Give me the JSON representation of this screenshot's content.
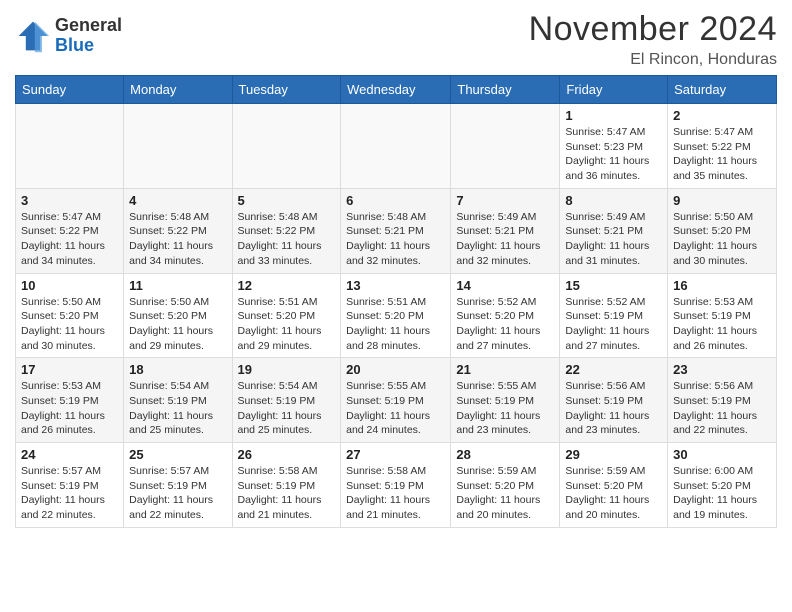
{
  "header": {
    "logo_line1": "General",
    "logo_line2": "Blue",
    "month": "November 2024",
    "location": "El Rincon, Honduras"
  },
  "weekdays": [
    "Sunday",
    "Monday",
    "Tuesday",
    "Wednesday",
    "Thursday",
    "Friday",
    "Saturday"
  ],
  "rows": [
    {
      "cells": [
        {
          "day": "",
          "info": ""
        },
        {
          "day": "",
          "info": ""
        },
        {
          "day": "",
          "info": ""
        },
        {
          "day": "",
          "info": ""
        },
        {
          "day": "",
          "info": ""
        },
        {
          "day": "1",
          "sunrise": "5:47 AM",
          "sunset": "5:23 PM",
          "daylight": "11 hours and 36 minutes."
        },
        {
          "day": "2",
          "sunrise": "5:47 AM",
          "sunset": "5:22 PM",
          "daylight": "11 hours and 35 minutes."
        }
      ]
    },
    {
      "cells": [
        {
          "day": "3",
          "sunrise": "5:47 AM",
          "sunset": "5:22 PM",
          "daylight": "11 hours and 34 minutes."
        },
        {
          "day": "4",
          "sunrise": "5:48 AM",
          "sunset": "5:22 PM",
          "daylight": "11 hours and 34 minutes."
        },
        {
          "day": "5",
          "sunrise": "5:48 AM",
          "sunset": "5:22 PM",
          "daylight": "11 hours and 33 minutes."
        },
        {
          "day": "6",
          "sunrise": "5:48 AM",
          "sunset": "5:21 PM",
          "daylight": "11 hours and 32 minutes."
        },
        {
          "day": "7",
          "sunrise": "5:49 AM",
          "sunset": "5:21 PM",
          "daylight": "11 hours and 32 minutes."
        },
        {
          "day": "8",
          "sunrise": "5:49 AM",
          "sunset": "5:21 PM",
          "daylight": "11 hours and 31 minutes."
        },
        {
          "day": "9",
          "sunrise": "5:50 AM",
          "sunset": "5:20 PM",
          "daylight": "11 hours and 30 minutes."
        }
      ]
    },
    {
      "cells": [
        {
          "day": "10",
          "sunrise": "5:50 AM",
          "sunset": "5:20 PM",
          "daylight": "11 hours and 30 minutes."
        },
        {
          "day": "11",
          "sunrise": "5:50 AM",
          "sunset": "5:20 PM",
          "daylight": "11 hours and 29 minutes."
        },
        {
          "day": "12",
          "sunrise": "5:51 AM",
          "sunset": "5:20 PM",
          "daylight": "11 hours and 29 minutes."
        },
        {
          "day": "13",
          "sunrise": "5:51 AM",
          "sunset": "5:20 PM",
          "daylight": "11 hours and 28 minutes."
        },
        {
          "day": "14",
          "sunrise": "5:52 AM",
          "sunset": "5:20 PM",
          "daylight": "11 hours and 27 minutes."
        },
        {
          "day": "15",
          "sunrise": "5:52 AM",
          "sunset": "5:19 PM",
          "daylight": "11 hours and 27 minutes."
        },
        {
          "day": "16",
          "sunrise": "5:53 AM",
          "sunset": "5:19 PM",
          "daylight": "11 hours and 26 minutes."
        }
      ]
    },
    {
      "cells": [
        {
          "day": "17",
          "sunrise": "5:53 AM",
          "sunset": "5:19 PM",
          "daylight": "11 hours and 26 minutes."
        },
        {
          "day": "18",
          "sunrise": "5:54 AM",
          "sunset": "5:19 PM",
          "daylight": "11 hours and 25 minutes."
        },
        {
          "day": "19",
          "sunrise": "5:54 AM",
          "sunset": "5:19 PM",
          "daylight": "11 hours and 25 minutes."
        },
        {
          "day": "20",
          "sunrise": "5:55 AM",
          "sunset": "5:19 PM",
          "daylight": "11 hours and 24 minutes."
        },
        {
          "day": "21",
          "sunrise": "5:55 AM",
          "sunset": "5:19 PM",
          "daylight": "11 hours and 23 minutes."
        },
        {
          "day": "22",
          "sunrise": "5:56 AM",
          "sunset": "5:19 PM",
          "daylight": "11 hours and 23 minutes."
        },
        {
          "day": "23",
          "sunrise": "5:56 AM",
          "sunset": "5:19 PM",
          "daylight": "11 hours and 22 minutes."
        }
      ]
    },
    {
      "cells": [
        {
          "day": "24",
          "sunrise": "5:57 AM",
          "sunset": "5:19 PM",
          "daylight": "11 hours and 22 minutes."
        },
        {
          "day": "25",
          "sunrise": "5:57 AM",
          "sunset": "5:19 PM",
          "daylight": "11 hours and 22 minutes."
        },
        {
          "day": "26",
          "sunrise": "5:58 AM",
          "sunset": "5:19 PM",
          "daylight": "11 hours and 21 minutes."
        },
        {
          "day": "27",
          "sunrise": "5:58 AM",
          "sunset": "5:19 PM",
          "daylight": "11 hours and 21 minutes."
        },
        {
          "day": "28",
          "sunrise": "5:59 AM",
          "sunset": "5:20 PM",
          "daylight": "11 hours and 20 minutes."
        },
        {
          "day": "29",
          "sunrise": "5:59 AM",
          "sunset": "5:20 PM",
          "daylight": "11 hours and 20 minutes."
        },
        {
          "day": "30",
          "sunrise": "6:00 AM",
          "sunset": "5:20 PM",
          "daylight": "11 hours and 19 minutes."
        }
      ]
    }
  ]
}
